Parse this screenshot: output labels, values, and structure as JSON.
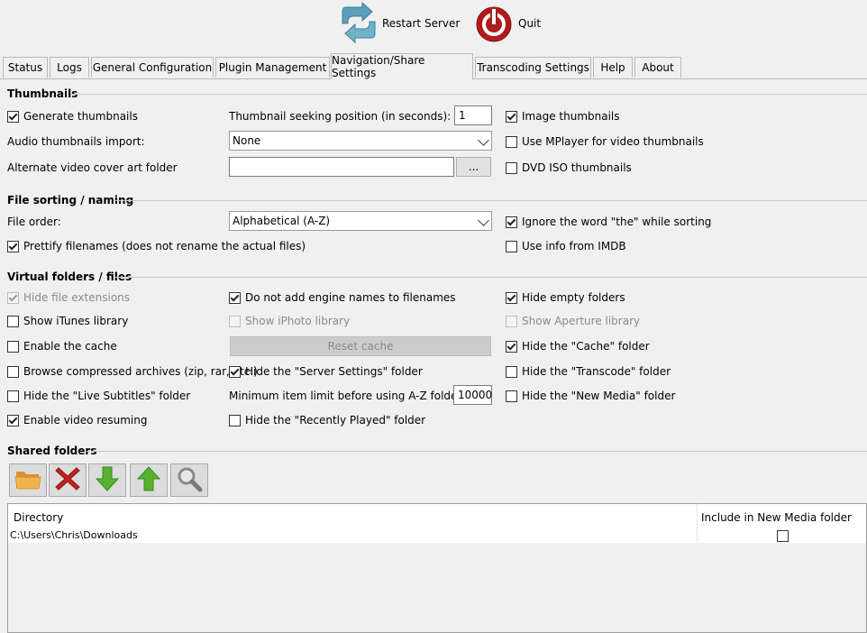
{
  "toolbar": {
    "restart_label": "Restart Server",
    "quit_label": "Quit"
  },
  "tabs": [
    {
      "label": "Status"
    },
    {
      "label": "Logs"
    },
    {
      "label": "General Configuration"
    },
    {
      "label": "Plugin Management"
    },
    {
      "label": "Navigation/Share Settings",
      "active": true
    },
    {
      "label": "Transcoding Settings"
    },
    {
      "label": "Help"
    },
    {
      "label": "About"
    }
  ],
  "thumbnails": {
    "title": "Thumbnails",
    "generate_thumbnails": {
      "label": "Generate thumbnails",
      "checked": true
    },
    "seek_label": "Thumbnail seeking position (in seconds):",
    "seek_value": "1",
    "image_thumbnails": {
      "label": "Image thumbnails",
      "checked": true
    },
    "audio_import_label": "Audio thumbnails import:",
    "audio_import_value": "None",
    "use_mplayer": {
      "label": "Use MPlayer for video thumbnails",
      "checked": false
    },
    "alt_cover_label": "Alternate video cover art folder",
    "alt_cover_value": "",
    "browse_label": "...",
    "dvd_iso": {
      "label": "DVD ISO thumbnails",
      "checked": false
    }
  },
  "sorting": {
    "title": "File sorting / naming",
    "file_order_label": "File order:",
    "file_order_value": "Alphabetical (A-Z)",
    "ignore_the": {
      "label": "Ignore the word \"the\" while sorting",
      "checked": true
    },
    "prettify": {
      "label": "Prettify filenames (does not rename the actual files)",
      "checked": true
    },
    "imdb": {
      "label": "Use info from IMDB",
      "checked": false
    }
  },
  "virtual": {
    "title": "Virtual folders / files",
    "hide_ext": {
      "label": "Hide file extensions",
      "checked": true,
      "disabled": true
    },
    "no_engine": {
      "label": "Do not add engine names to filenames",
      "checked": true
    },
    "hide_empty": {
      "label": "Hide empty folders",
      "checked": true
    },
    "itunes": {
      "label": "Show iTunes library",
      "checked": false
    },
    "iphoto": {
      "label": "Show iPhoto library",
      "checked": false,
      "disabled": true
    },
    "aperture": {
      "label": "Show Aperture library",
      "checked": false,
      "disabled": true
    },
    "cache": {
      "label": "Enable the cache",
      "checked": false
    },
    "reset_cache_label": "Reset cache",
    "hide_cache": {
      "label": "Hide the \"Cache\" folder",
      "checked": true
    },
    "compressed": {
      "label": "Browse compressed archives (zip, rar, etc.)",
      "checked": false
    },
    "hide_server": {
      "label": "Hide the \"Server Settings\" folder",
      "checked": true
    },
    "hide_transcode": {
      "label": "Hide the \"Transcode\" folder",
      "checked": false
    },
    "hide_live": {
      "label": "Hide the \"Live Subtitles\" folder",
      "checked": false
    },
    "az_label": "Minimum item limit before using A-Z folders:",
    "az_value": "10000",
    "hide_newmedia": {
      "label": "Hide the \"New Media\" folder",
      "checked": false
    },
    "resume": {
      "label": "Enable video resuming",
      "checked": true
    },
    "hide_recent": {
      "label": "Hide the \"Recently Played\" folder",
      "checked": false
    }
  },
  "shared": {
    "title": "Shared folders",
    "col_directory": "Directory",
    "col_newmedia": "Include in New Media folder",
    "rows": [
      {
        "directory": "C:\\Users\\Chris\\Downloads",
        "new_media": false
      }
    ]
  },
  "colors": {
    "quit_red": "#b01c1c",
    "delete_red": "#c0211f",
    "arrow_green": "#58b130",
    "folder_orange": "#e8a33a"
  }
}
